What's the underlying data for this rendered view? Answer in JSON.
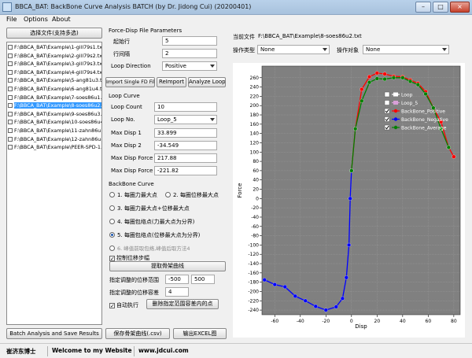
{
  "window": {
    "title": "BBCA_BAT: BackBone Curve Analysis BATCH (by Dr. Jidong Cui) (20200401)",
    "min": "–",
    "max": "□",
    "close": "×"
  },
  "menu": [
    "File",
    "Options",
    "About"
  ],
  "left": {
    "select_files_button": "选择文件(支持多选)",
    "files": [
      {
        "label": "F:\\BBCA_BAT\\Example\\1-gill79s1.txt",
        "selected": false
      },
      {
        "label": "F:\\BBCA_BAT\\Example\\2-gill79s2.txt",
        "selected": false
      },
      {
        "label": "F:\\BBCA_BAT\\Example\\3-gill79s3.txt",
        "selected": false
      },
      {
        "label": "F:\\BBCA_BAT\\Example\\4-gill79s4.txt",
        "selected": false
      },
      {
        "label": "F:\\BBCA_BAT\\Example\\5-ang81u3.txt",
        "selected": false
      },
      {
        "label": "F:\\BBCA_BAT\\Example\\6-ang81u4.txt",
        "selected": false
      },
      {
        "label": "F:\\BBCA_BAT\\Example\\7-soes86u1.txt",
        "selected": false
      },
      {
        "label": "F:\\BBCA_BAT\\Example\\8-soes86u2.txt",
        "selected": true
      },
      {
        "label": "F:\\BBCA_BAT\\Example\\9-soes86u3.txt",
        "selected": false
      },
      {
        "label": "F:\\BBCA_BAT\\Example\\10-soes86u4.txt",
        "selected": false
      },
      {
        "label": "F:\\BBCA_BAT\\Example\\11-zahn86u7.txt",
        "selected": false
      },
      {
        "label": "F:\\BBCA_BAT\\Example\\12-zahn86u8.txt",
        "selected": false
      },
      {
        "label": "F:\\BBCA_BAT\\Example\\PEER-SPD-1.txt",
        "selected": false
      }
    ],
    "batch_button": "Batch Analysis and Save Results"
  },
  "params": {
    "header": "Force-Disp File Parameters",
    "start_row_label": "起始行",
    "start_row_value": "5",
    "row_interval_label": "行间隔",
    "row_interval_value": "2",
    "loop_direction_label": "Loop Direction",
    "loop_direction_value": "Positive",
    "import_single_button": "Import Single FD File",
    "reimport_button": "ReImport",
    "analyze_loop_button": "Analyze Loop"
  },
  "loop": {
    "header": "Loop Curve",
    "count_label": "Loop Count",
    "count_value": "10",
    "no_label": "Loop No.",
    "no_value": "Loop_5",
    "max_disp1_label": "Max Disp 1",
    "max_disp1_value": "33.899",
    "max_disp2_label": "Max Disp 2",
    "max_disp2_value": "-34.549",
    "max_force1_label": "Max Disp Force 1",
    "max_force1_value": "217.88",
    "max_force2_label": "Max Disp Force 2",
    "max_force2_value": "-221.82"
  },
  "backbone": {
    "header": "BackBone Curve",
    "opt1": "1. 每圈力最大点",
    "opt2": "2. 每圈位移最大点",
    "opt3": "3. 每圈力最大点+位移最大点",
    "opt4": "4. 每圈包络点(力最大点为分界)",
    "opt5": "5. 每圈包络点(位移最大点为分界)",
    "opt6": "6. 峰值前取包络,峰值后取方法4",
    "control_disp_label": "控制位移步幅",
    "extract_button": "提取骨架曲线",
    "range_label": "指定调整的位移范围",
    "range_min": "-500",
    "range_max": "500",
    "tolerance_label": "指定调整的位移容差",
    "tolerance_value": "4",
    "auto_exec_label": "自动执行",
    "delete_points_button": "删除指定范围容差内的点",
    "save_button": "保存骨架曲线(.csv)",
    "export_excel_button": "输出EXCEL图"
  },
  "right": {
    "current_file_label": "当前文件",
    "current_file_value": "F:\\BBCA_BAT\\Example\\8-soes86u2.txt",
    "op_type_label": "操作类型",
    "op_type_value": "None",
    "op_target_label": "操作对象",
    "op_target_value": "None"
  },
  "status": {
    "author": "崔济东博士",
    "welcome": "Welcome to my Website",
    "url": "www.jdcui.com"
  },
  "chart_data": {
    "type": "line",
    "xlabel": "Disp",
    "ylabel": "Force",
    "xlim": [
      -70,
      85
    ],
    "ylim": [
      -250,
      285
    ],
    "xticks": [
      -60,
      -40,
      -20,
      0,
      20,
      40,
      60,
      80
    ],
    "yticks": [
      -240,
      -220,
      -200,
      -180,
      -160,
      -140,
      -120,
      -100,
      -80,
      -60,
      -40,
      -20,
      0,
      20,
      40,
      60,
      80,
      100,
      120,
      140,
      160,
      180,
      200,
      220,
      240,
      260
    ],
    "legend_placement": "top-right",
    "series": [
      {
        "name": "Loop",
        "color": "#ffffff",
        "checked": false,
        "visible": false,
        "points": []
      },
      {
        "name": "Loop_5",
        "color": "#d8a0d8",
        "checked": false,
        "visible": false,
        "points": []
      },
      {
        "name": "BackBone_Positive",
        "color": "#ff0000",
        "checked": true,
        "visible": true,
        "points": [
          [
            0,
            60
          ],
          [
            3,
            150
          ],
          [
            8,
            235
          ],
          [
            14,
            262
          ],
          [
            20,
            270
          ],
          [
            26,
            268
          ],
          [
            33,
            263
          ],
          [
            40,
            262
          ],
          [
            46,
            255
          ],
          [
            52,
            248
          ],
          [
            58,
            230
          ],
          [
            64,
            195
          ],
          [
            70,
            165
          ],
          [
            76,
            110
          ],
          [
            80,
            90
          ]
        ]
      },
      {
        "name": "BackBone_Negative",
        "color": "#0000ff",
        "checked": true,
        "visible": true,
        "points": [
          [
            0,
            60
          ],
          [
            -1,
            0
          ],
          [
            -2,
            -100
          ],
          [
            -4,
            -170
          ],
          [
            -7,
            -215
          ],
          [
            -12,
            -233
          ],
          [
            -20,
            -240
          ],
          [
            -28,
            -232
          ],
          [
            -36,
            -220
          ],
          [
            -44,
            -210
          ],
          [
            -52,
            -190
          ],
          [
            -60,
            -185
          ],
          [
            -68,
            -175
          ]
        ]
      },
      {
        "name": "BackBone_Average",
        "color": "#008000",
        "checked": true,
        "visible": true,
        "points": [
          [
            0,
            60
          ],
          [
            3,
            150
          ],
          [
            8,
            210
          ],
          [
            14,
            250
          ],
          [
            20,
            258
          ],
          [
            26,
            257
          ],
          [
            33,
            260
          ],
          [
            40,
            260
          ],
          [
            46,
            252
          ],
          [
            52,
            245
          ],
          [
            58,
            225
          ],
          [
            64,
            195
          ],
          [
            70,
            150
          ],
          [
            76,
            110
          ]
        ]
      }
    ]
  }
}
